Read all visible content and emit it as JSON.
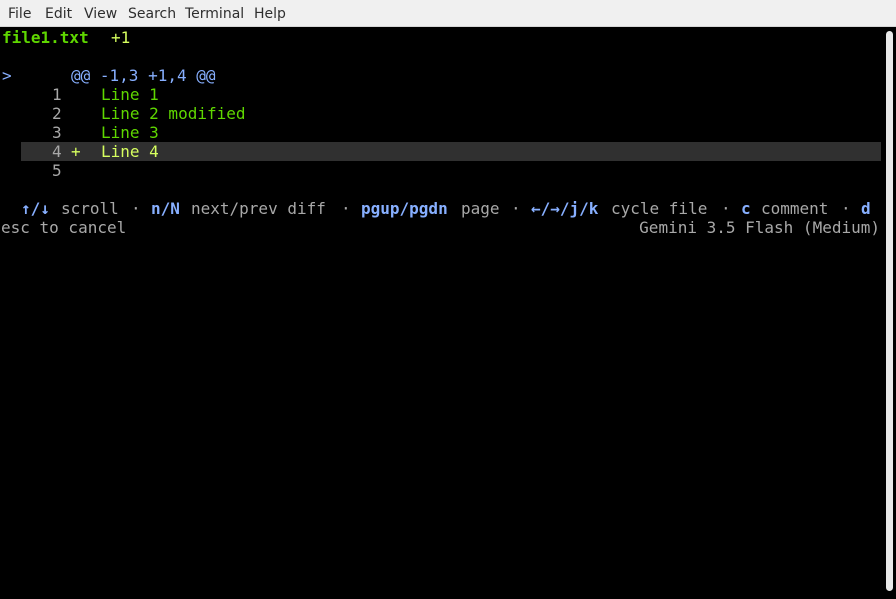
{
  "menu": {
    "items": [
      "File",
      "Edit",
      "View",
      "Search",
      "Terminal",
      "Help"
    ]
  },
  "header": {
    "filename": "file1.txt",
    "change_count": "+1"
  },
  "diff": {
    "cursor": ">",
    "hunk_header": "@@ -1,3 +1,4 @@",
    "lines": [
      {
        "num": "1",
        "marker": "",
        "text": "Line 1"
      },
      {
        "num": "2",
        "marker": "",
        "text": "Line 2 modified"
      },
      {
        "num": "3",
        "marker": "",
        "text": "Line 3"
      },
      {
        "num": "4",
        "marker": "+",
        "text": "Line 4"
      },
      {
        "num": "5",
        "marker": "",
        "text": ""
      }
    ]
  },
  "help": {
    "scroll_key": "↑/↓",
    "scroll_label": "scroll",
    "sep": "·",
    "next_key": "n/N",
    "next_label": "next/prev diff",
    "page_key": "pgup/pgdn",
    "page_label": "page",
    "cycle_key": "←/→/j/k",
    "cycle_label": "cycle file",
    "comment_key": "c",
    "comment_label": "comment",
    "d_key": "d"
  },
  "status": {
    "cancel_hint": "esc to cancel",
    "model": "Gemini 3.5 Flash (Medium)"
  },
  "colors": {
    "terminal_bg": "#000000",
    "green": "#5fd700",
    "yellow_green": "#d7ff5f",
    "blue": "#87afff",
    "gray": "#a8a8a8",
    "highlight_row": "#303030",
    "menubar_bg": "#f0f0f0"
  }
}
